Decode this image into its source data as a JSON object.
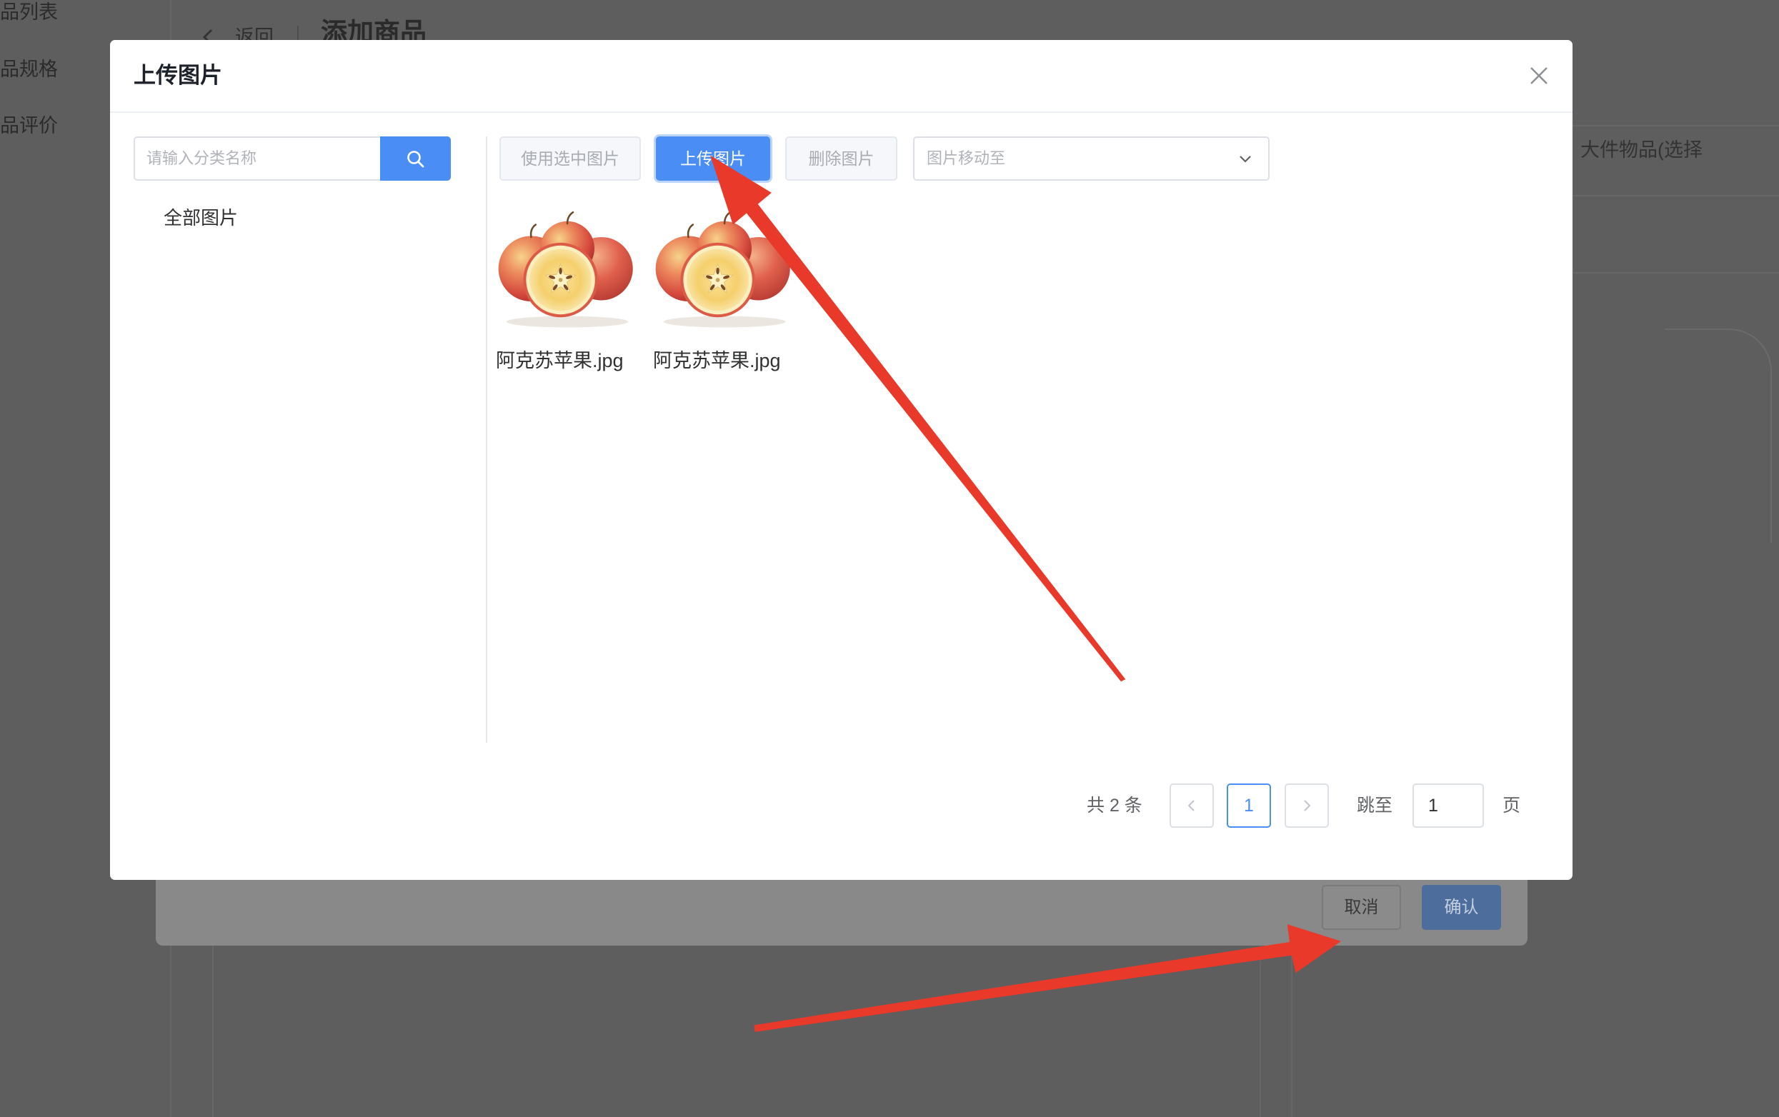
{
  "background": {
    "sidebar_items": [
      "品列表",
      "品规格",
      "品评价"
    ],
    "back_label": "返回",
    "page_title": "添加商品",
    "right_text": "大件物品(选择",
    "cancel_label": "取消",
    "confirm_label": "确认"
  },
  "dialog": {
    "title": "上传图片",
    "search": {
      "placeholder": "请输入分类名称",
      "value": ""
    },
    "categories": [
      {
        "label": "全部图片"
      }
    ],
    "toolbar": {
      "use_selected": "使用选中图片",
      "upload": "上传图片",
      "delete": "删除图片",
      "move_placeholder": "图片移动至"
    },
    "images": [
      {
        "name": "阿克苏苹果.jpg"
      },
      {
        "name": "阿克苏苹果.jpg"
      }
    ],
    "pagination": {
      "total_text": "共 2 条",
      "current_page": "1",
      "jump_label": "跳至",
      "jump_value": "1",
      "page_suffix": "页"
    }
  },
  "icons": {
    "close": "close-icon",
    "search": "search-icon",
    "select": "chevron-down-icon",
    "prev": "chevron-left-icon",
    "next": "chevron-right-icon",
    "back": "chevron-left-icon"
  },
  "colors": {
    "primary": "#4a8df5",
    "overlay": "#5e5e5e",
    "annotation_arrow": "#e8392b"
  }
}
